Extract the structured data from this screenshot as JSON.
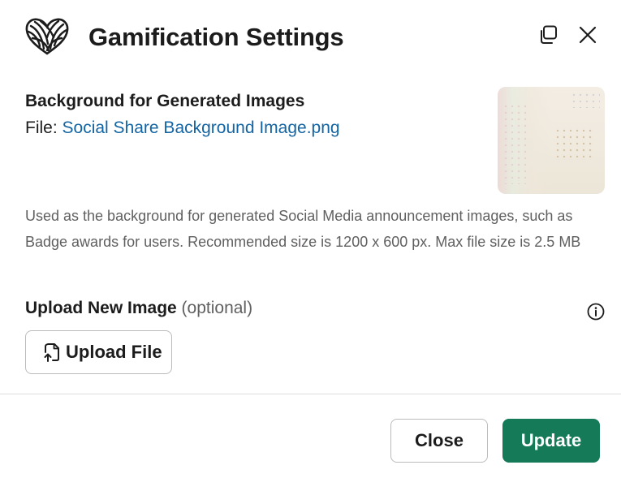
{
  "header": {
    "title": "Gamification Settings",
    "logo_icon": "heart-yarn-icon",
    "popout_icon": "popout-icon",
    "close_icon": "close-icon"
  },
  "background_section": {
    "title": "Background for Generated Images",
    "file_prefix": "File:",
    "file_name": "Social Share Background Image.png",
    "description": "Used as the background for generated Social Media announcement images, such as Badge awards for users. Recommended size is 1200 x 600 px. Max file size is 2.5 MB"
  },
  "upload": {
    "label": "Upload New Image",
    "optional": "(optional)",
    "button_label": "Upload File",
    "button_icon": "file-upload-icon",
    "info_icon": "info-icon"
  },
  "footer": {
    "close_label": "Close",
    "update_label": "Update"
  },
  "colors": {
    "link": "#1264a3",
    "primary_button": "#157a57",
    "text": "#1d1c1d",
    "muted_text": "#616061"
  }
}
